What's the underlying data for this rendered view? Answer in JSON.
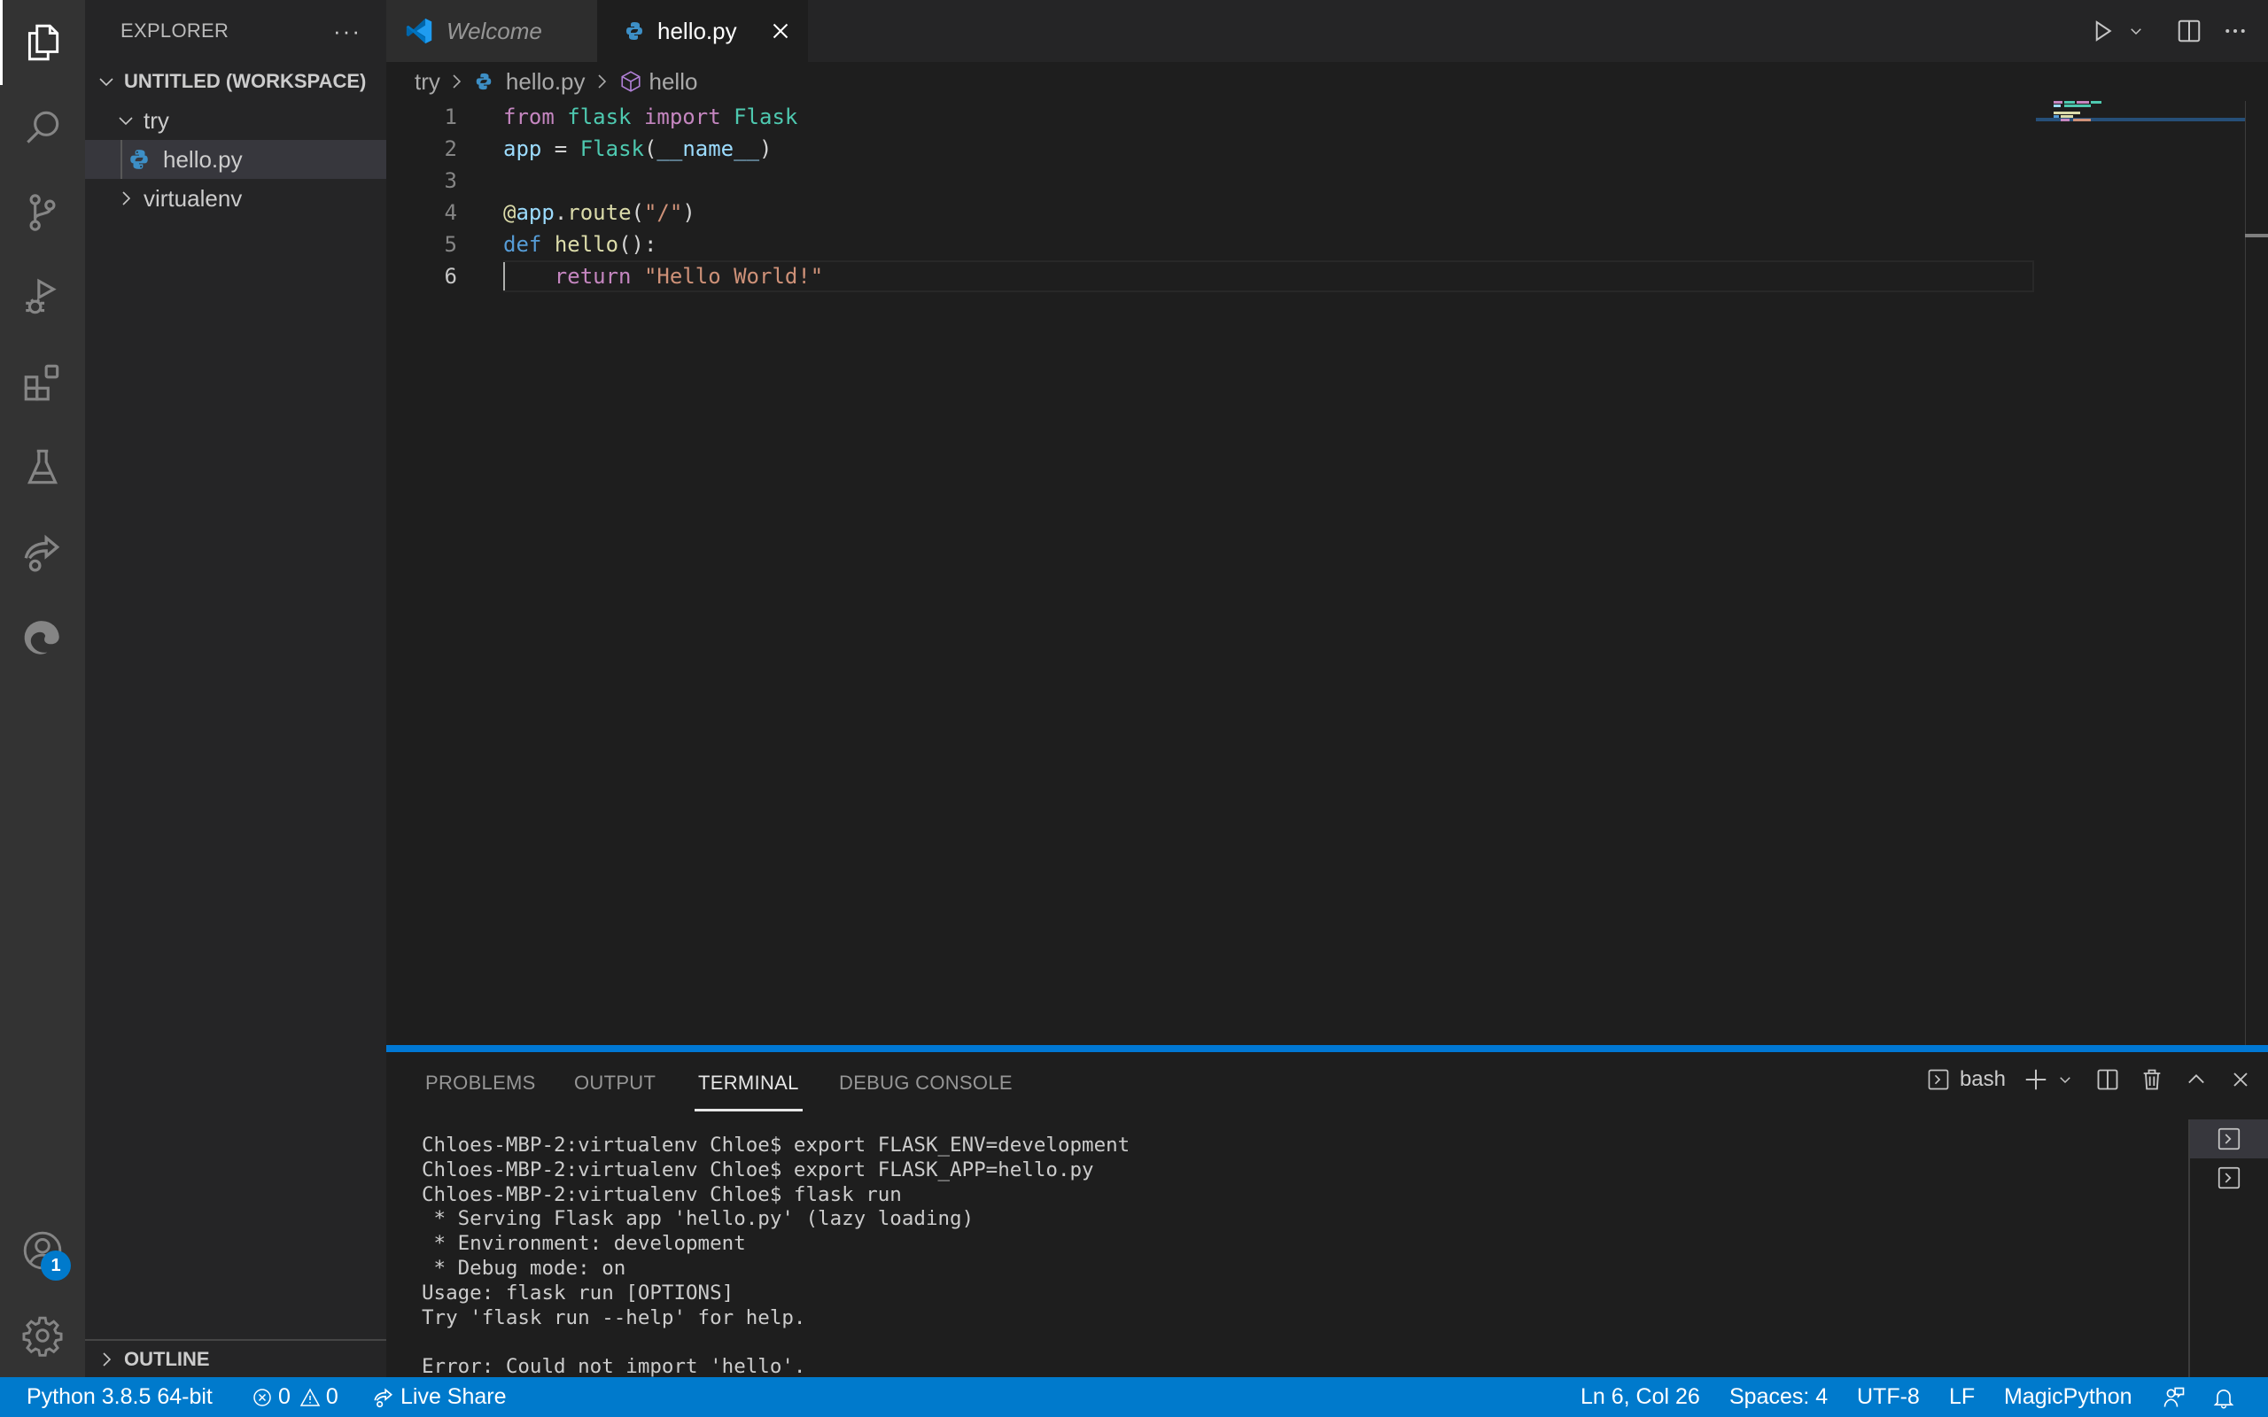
{
  "activity_bar": {
    "items": [
      {
        "name": "explorer",
        "icon": "files-icon",
        "active": true
      },
      {
        "name": "search",
        "icon": "search-icon"
      },
      {
        "name": "source-control",
        "icon": "source-control-icon"
      },
      {
        "name": "run-debug",
        "icon": "run-debug-icon"
      },
      {
        "name": "extensions",
        "icon": "extensions-icon"
      },
      {
        "name": "testing",
        "icon": "flask-beaker-icon"
      },
      {
        "name": "live-share",
        "icon": "live-share-icon"
      },
      {
        "name": "edge-devtools",
        "icon": "edge-icon"
      }
    ],
    "accounts_badge": "1"
  },
  "sidebar": {
    "title": "EXPLORER",
    "more_label": "···",
    "workspace": "UNTITLED (WORKSPACE)",
    "tree": [
      {
        "label": "try",
        "type": "folder",
        "expanded": true
      },
      {
        "label": "hello.py",
        "type": "file",
        "selected": true
      },
      {
        "label": "virtualenv",
        "type": "folder",
        "expanded": false
      }
    ],
    "outline_label": "OUTLINE"
  },
  "tabs": [
    {
      "label": "Welcome",
      "icon": "vscode-logo-icon",
      "active": false,
      "preview": true
    },
    {
      "label": "hello.py",
      "icon": "python-icon",
      "active": true
    }
  ],
  "breadcrumb": [
    "try",
    "hello.py",
    "hello"
  ],
  "editor": {
    "lines": [
      {
        "n": "1",
        "tokens": [
          [
            "kw",
            "from"
          ],
          [
            "plain",
            " "
          ],
          [
            "mod",
            "flask"
          ],
          [
            "plain",
            " "
          ],
          [
            "kw",
            "import"
          ],
          [
            "plain",
            " "
          ],
          [
            "mod",
            "Flask"
          ]
        ]
      },
      {
        "n": "2",
        "tokens": [
          [
            "var",
            "app"
          ],
          [
            "plain",
            " = "
          ],
          [
            "mod",
            "Flask"
          ],
          [
            "plain",
            "("
          ],
          [
            "var",
            "__name__"
          ],
          [
            "plain",
            ")"
          ]
        ]
      },
      {
        "n": "3",
        "tokens": []
      },
      {
        "n": "4",
        "tokens": [
          [
            "dec",
            "@"
          ],
          [
            "var",
            "app"
          ],
          [
            "plain",
            "."
          ],
          [
            "fn",
            "route"
          ],
          [
            "plain",
            "("
          ],
          [
            "str",
            "\"/\""
          ],
          [
            "plain",
            ")"
          ]
        ]
      },
      {
        "n": "5",
        "tokens": [
          [
            "def",
            "def"
          ],
          [
            "plain",
            " "
          ],
          [
            "fn",
            "hello"
          ],
          [
            "plain",
            "():"
          ]
        ]
      },
      {
        "n": "6",
        "tokens": [
          [
            "plain",
            "    "
          ],
          [
            "kw",
            "return"
          ],
          [
            "plain",
            " "
          ],
          [
            "str",
            "\"Hello World!\""
          ]
        ]
      }
    ],
    "current_line": 6
  },
  "panel": {
    "tabs": [
      "PROBLEMS",
      "OUTPUT",
      "TERMINAL",
      "DEBUG CONSOLE"
    ],
    "active_tab": "TERMINAL",
    "shell": "bash",
    "terminal_lines": [
      "Chloes-MBP-2:virtualenv Chloe$ export FLASK_ENV=development",
      "Chloes-MBP-2:virtualenv Chloe$ export FLASK_APP=hello.py",
      "Chloes-MBP-2:virtualenv Chloe$ flask run",
      " * Serving Flask app 'hello.py' (lazy loading)",
      " * Environment: development",
      " * Debug mode: on",
      "Usage: flask run [OPTIONS]",
      "Try 'flask run --help' for help.",
      "",
      "Error: Could not import 'hello'."
    ]
  },
  "statusbar": {
    "interpreter": "Python 3.8.5 64-bit",
    "errors": "0",
    "warnings": "0",
    "live_share": "Live Share",
    "position": "Ln 6, Col 26",
    "spaces": "Spaces: 4",
    "encoding": "UTF-8",
    "eol": "LF",
    "language": "MagicPython"
  },
  "colors": {
    "accent": "#007acc",
    "keyword": "#c586c0",
    "type": "#4ec9b0",
    "variable": "#9cdcfe",
    "function": "#dcdcaa",
    "string": "#ce9178",
    "def": "#569cd6"
  }
}
